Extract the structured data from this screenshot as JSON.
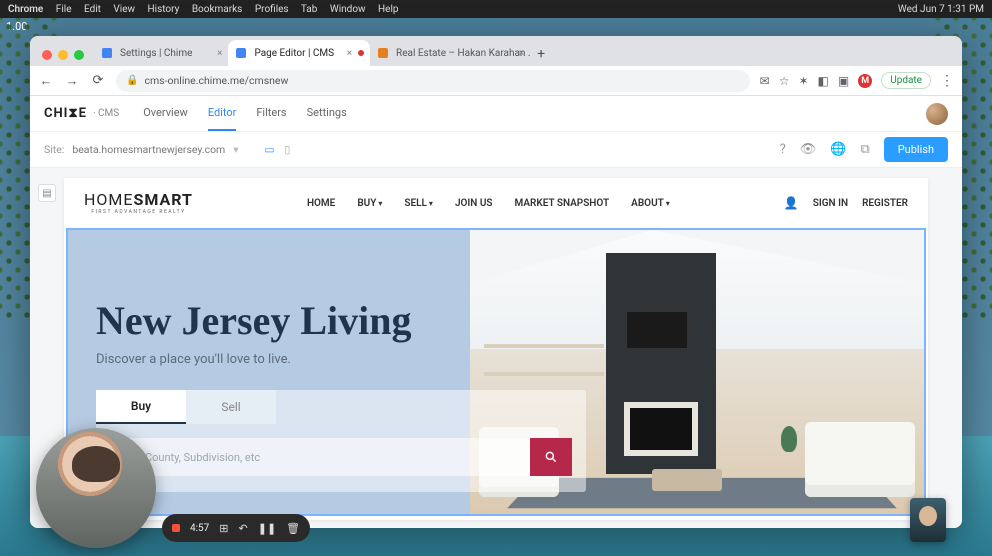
{
  "mac_menu": {
    "app": "Chrome",
    "items": [
      "File",
      "Edit",
      "View",
      "History",
      "Bookmarks",
      "Profiles",
      "Tab",
      "Window",
      "Help"
    ],
    "right": "Wed Jun 7  1:31 PM"
  },
  "corner_value": "1.00",
  "browser": {
    "tabs": [
      {
        "title": "Settings | Chime",
        "active": false,
        "fav": "fav-blue",
        "modified": false
      },
      {
        "title": "Page Editor | CMS",
        "active": true,
        "fav": "fav-blue",
        "modified": true
      },
      {
        "title": "Real Estate – Hakan Karahan ...",
        "active": false,
        "fav": "fav-orange",
        "modified": false
      }
    ],
    "url": "cms-online.chime.me/cmsnew",
    "update_label": "Update",
    "avatar_letter": "M"
  },
  "cms": {
    "brand": "CHI⧗E",
    "brand_sub": "· CMS",
    "tabs": {
      "overview": "Overview",
      "editor": "Editor",
      "filters": "Filters",
      "settings": "Settings"
    },
    "site_label": "Site:",
    "site_value": "beata.homesmartnewjersey.com",
    "publish": "Publish"
  },
  "site": {
    "logo_top": "HOMESMART",
    "logo_sub": "FIRST ADVANTAGE REALTY",
    "nav": {
      "home": "HOME",
      "buy": "BUY",
      "sell": "SELL",
      "join": "JOIN US",
      "snapshot": "MARKET SNAPSHOT",
      "about": "ABOUT"
    },
    "signin": "SIGN IN",
    "register": "REGISTER"
  },
  "hero": {
    "title": "New Jersey Living",
    "subtitle": "Discover a place you'll love to live.",
    "tabs": {
      "buy": "Buy",
      "sell": "Sell"
    },
    "placeholder": "City, County, Subdivision, etc"
  },
  "recorder": {
    "time": "4:57"
  }
}
